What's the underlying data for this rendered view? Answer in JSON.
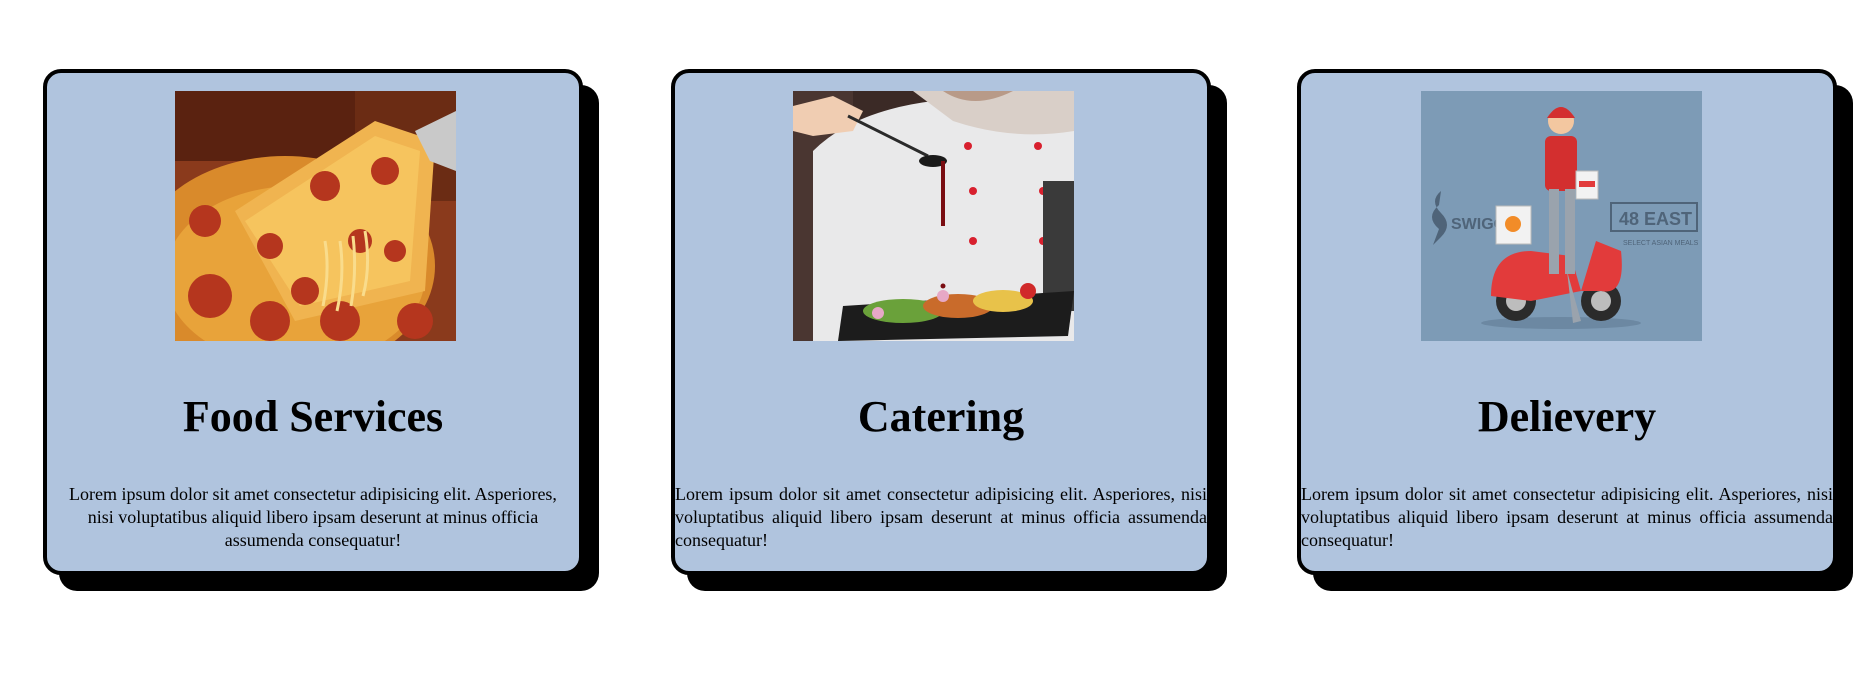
{
  "cards": [
    {
      "image": "pizza-slice-photo",
      "title": "Food Services",
      "text": "Lorem ipsum dolor sit amet consectetur adipisicing elit. Asperiores, nisi voluptatibus aliquid libero ipsam deserunt at minus officia assumenda consequatur!"
    },
    {
      "image": "chef-plating-dish-photo",
      "title": "Catering",
      "text": "Lorem ipsum dolor sit amet consectetur adipisicing elit. Asperiores, nisi voluptatibus aliquid libero ipsam deserunt at minus officia assumenda consequatur!"
    },
    {
      "image": "delivery-rider-scooter-photo",
      "title": "Delievery",
      "text": "Lorem ipsum dolor sit amet consectetur adipisicing elit. Asperiores, nisi voluptatibus aliquid libero ipsam deserunt at minus officia assumenda consequatur!",
      "image_texts": [
        "SWIGGY",
        "48 EAST",
        "SELECT ASIAN MEALS"
      ]
    }
  ],
  "colors": {
    "card_background": "#b0c4de",
    "card_border": "#000000",
    "card_shadow": "#000000",
    "page_background": "#ffffff",
    "delivery_bg": "#7d9bb6",
    "scooter_red": "#e23b3b",
    "pizza_cheese": "#e8a33a",
    "pepperoni": "#b5361e",
    "chef_coat": "#e9e9ea"
  }
}
